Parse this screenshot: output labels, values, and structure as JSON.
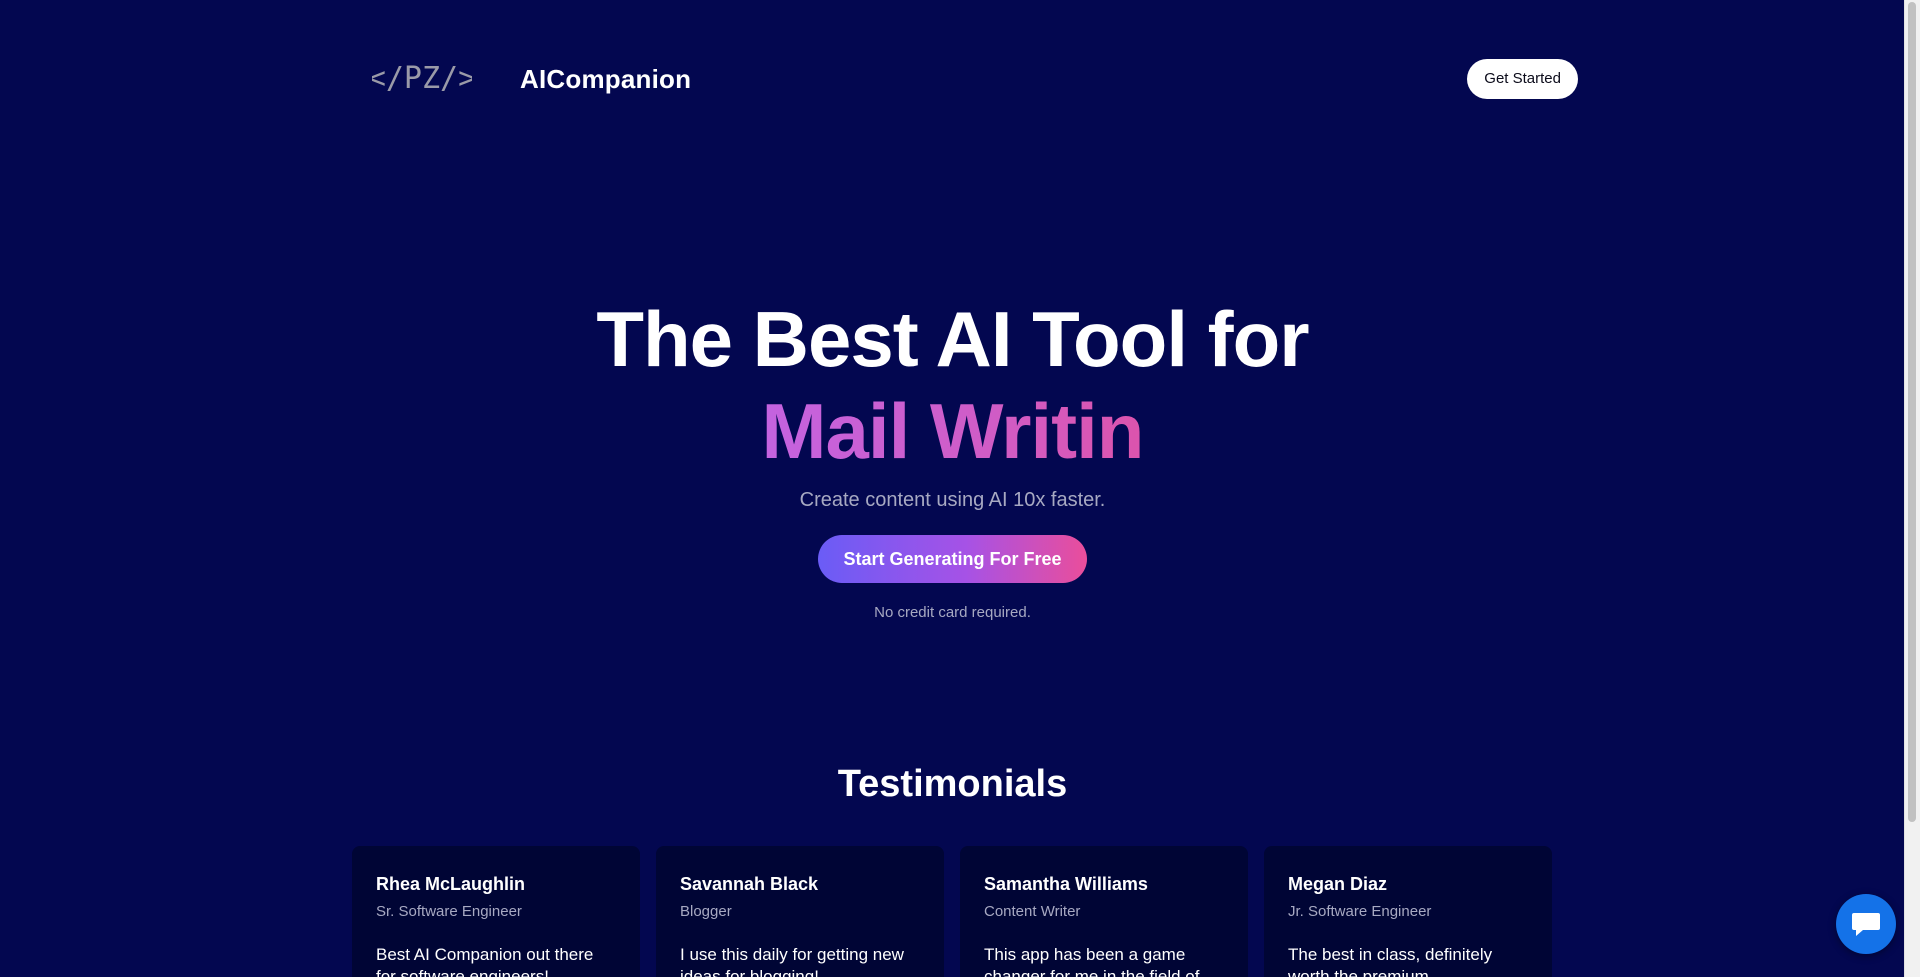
{
  "nav": {
    "brand": "AICompanion",
    "logo_text": "</PZ/>",
    "get_started_label": "Get Started"
  },
  "hero": {
    "title_line1": "The Best AI Tool for",
    "title_line2": "Mail Writin",
    "subtitle": "Create content using AI 10x faster.",
    "cta_label": "Start Generating For Free",
    "note": "No credit card required."
  },
  "testimonials": {
    "title": "Testimonials",
    "cards": [
      {
        "name": "Rhea McLaughlin",
        "role": "Sr. Software Engineer",
        "quote": "Best AI Companion out there for software engineers!"
      },
      {
        "name": "Savannah Black",
        "role": "Blogger",
        "quote": "I use this daily for getting new ideas for blogging!"
      },
      {
        "name": "Samantha Williams",
        "role": "Content Writer",
        "quote": "This app has been a game changer for me in the field of"
      },
      {
        "name": "Megan Diaz",
        "role": "Jr. Software Engineer",
        "quote": "The best in class, definitely worth the premium"
      }
    ]
  },
  "colors": {
    "background": "#030750",
    "card_background": "#000535",
    "accent_gradient_start": "#6a5cf6",
    "accent_gradient_end": "#ea4e9b",
    "chat_button": "#1472e8"
  },
  "icons": {
    "chat": "chat-bubble-icon",
    "logo": "code-brackets-logo"
  }
}
